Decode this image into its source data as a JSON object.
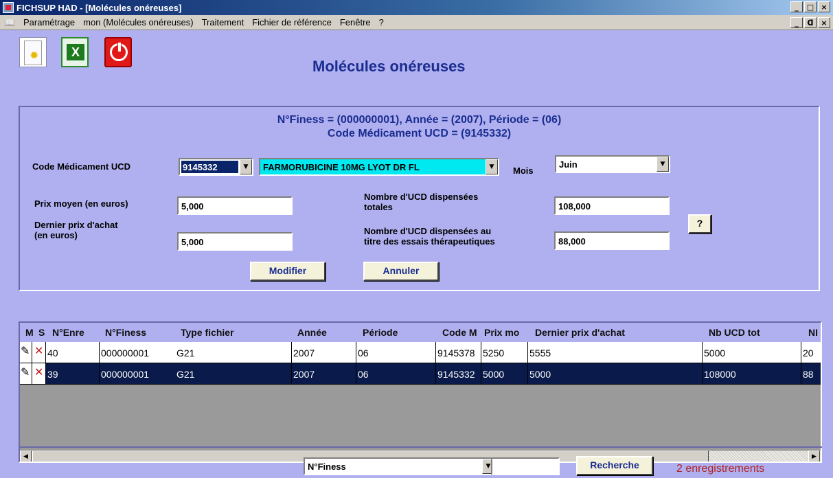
{
  "window": {
    "title": "FICHSUP HAD - [Molécules onéreuses]",
    "buttons": [
      "_",
      "□",
      "×"
    ],
    "mdi_buttons": [
      "_",
      "ᗡ",
      "×"
    ]
  },
  "menu": {
    "icon": "book-icon",
    "items": [
      {
        "label": "Paramétrage"
      },
      {
        "label": "mon (Molécules onéreuses)"
      },
      {
        "label": "Traitement"
      },
      {
        "label": "Fichier de référence"
      },
      {
        "label": "Fenêtre"
      },
      {
        "label": "?"
      }
    ]
  },
  "toolbar": {
    "new_icon": "new-document-icon",
    "excel_icon": "excel-export-icon",
    "exit_icon": "power-exit-icon"
  },
  "page_title": "Molécules onéreuses",
  "info": {
    "line1": "N°Finess = (000000001), Année = (2007), Période = (06)",
    "line2": "Code Médicament UCD = (9145332)"
  },
  "form": {
    "code_ucd_label": "Code Médicament UCD",
    "code_ucd_value": "9145332",
    "drug_name_value": "FARMORUBICINE 10MG LYOT DR FL",
    "mois_label": "Mois",
    "mois_value": "Juin",
    "prix_moyen_label": "Prix moyen (en euros)",
    "prix_moyen_value": "5,000",
    "dernier_prix_label_1": "Dernier prix d'achat",
    "dernier_prix_label_2": "(en euros)",
    "dernier_prix_value": "5,000",
    "nb_ucd_tot_label_1": "Nombre d'UCD dispensées",
    "nb_ucd_tot_label_2": "totales",
    "nb_ucd_tot_value": "108,000",
    "nb_ucd_essais_label_1": "Nombre d'UCD dispensées au",
    "nb_ucd_essais_label_2": "titre des essais thérapeutiques",
    "nb_ucd_essais_value": "88,000",
    "help_button": "?",
    "modifier_button": "Modifier",
    "annuler_button": "Annuler"
  },
  "grid": {
    "headers": [
      "M",
      "S",
      "N°Enre",
      "N°Finess",
      "Type fichier",
      "Année",
      "Période",
      "Code M",
      "Prix mo",
      "Dernier prix d'achat",
      "Nb UCD tot",
      "NI"
    ],
    "rows": [
      {
        "n_enr": "40",
        "finess": "000000001",
        "type": "G21",
        "annee": "2007",
        "periode": "06",
        "code": "9145378",
        "prix": "5250",
        "dernier": "5555",
        "nb_tot": "5000",
        "ni": "20",
        "selected": false
      },
      {
        "n_enr": "39",
        "finess": "000000001",
        "type": "G21",
        "annee": "2007",
        "periode": "06",
        "code": "9145332",
        "prix": "5000",
        "dernier": "5000",
        "nb_tot": "108000",
        "ni": "88",
        "selected": true
      }
    ]
  },
  "search": {
    "field_value": "N°Finess",
    "input_value": "",
    "button": "Recherche",
    "count": "2 enregistrements"
  }
}
